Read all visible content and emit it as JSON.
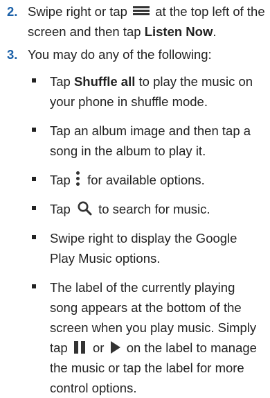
{
  "steps": [
    {
      "number": "2.",
      "text_before_icon": "Swipe right or tap",
      "icon": "menu-icon",
      "text_after_icon": "at the top left of the screen and then tap",
      "bold": "Listen Now",
      "text_end": "."
    },
    {
      "number": "3.",
      "text": "You may do any of the following:"
    }
  ],
  "bullets": [
    {
      "prefix": "Tap",
      "bold": "Shuffle all",
      "suffix": "to play the music on your phone in shuffle mode."
    },
    {
      "text": "Tap an album image and then tap a song in the album to play it."
    },
    {
      "prefix": "Tap",
      "icon": "more-options-icon",
      "suffix": "for available options."
    },
    {
      "prefix": "Tap",
      "icon": "search-icon",
      "suffix": "to search for music."
    },
    {
      "text": "Swipe right to display the Google Play Music options."
    },
    {
      "text_before_icon": "The label of the currently playing song appears at the bottom of the screen when you play music. Simply tap",
      "icon1": "pause-icon",
      "connector": "or",
      "icon2": "play-icon",
      "text_after_icons": "on the label to manage the music or tap the label for more control options."
    }
  ],
  "colors": {
    "step_number": "#1a60a8",
    "text": "#222222"
  }
}
